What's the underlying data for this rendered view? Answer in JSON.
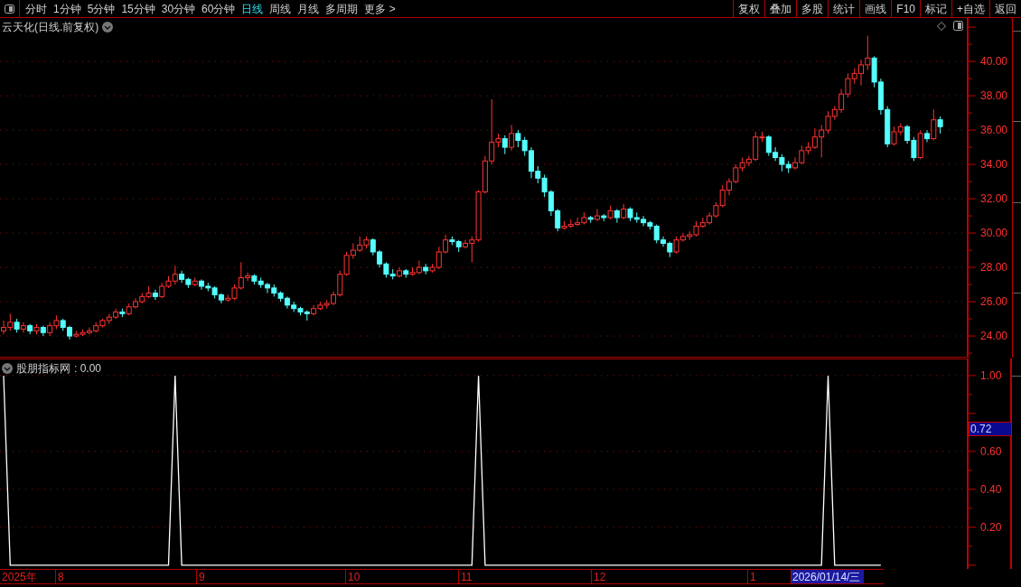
{
  "toolbar": {
    "periods": [
      {
        "label": "分时",
        "selected": false
      },
      {
        "label": "1分钟",
        "selected": false
      },
      {
        "label": "5分钟",
        "selected": false
      },
      {
        "label": "15分钟",
        "selected": false
      },
      {
        "label": "30分钟",
        "selected": false
      },
      {
        "label": "60分钟",
        "selected": false
      },
      {
        "label": "日线",
        "selected": true
      },
      {
        "label": "周线",
        "selected": false
      },
      {
        "label": "月线",
        "selected": false
      },
      {
        "label": "多周期",
        "selected": false
      },
      {
        "label": "更多 >",
        "selected": false
      }
    ],
    "actions": [
      "复权",
      "叠加",
      "多股",
      "统计",
      "画线",
      "F10",
      "标记",
      "+自选",
      "返回"
    ]
  },
  "price_panel": {
    "title": "云天化(日线.前复权)",
    "chart_data": {
      "type": "candlestick",
      "ylim": [
        22.74,
        42.53
      ],
      "grid": true,
      "yticks": [
        {
          "value": 40,
          "label": "40.00"
        },
        {
          "value": 38,
          "label": "38.00"
        },
        {
          "value": 36,
          "label": "36.00"
        },
        {
          "value": 34,
          "label": "34.00"
        },
        {
          "value": 32,
          "label": "32.00"
        },
        {
          "value": 30,
          "label": "30.00"
        },
        {
          "value": 28,
          "label": "28.00"
        },
        {
          "value": 26,
          "label": "26.00"
        },
        {
          "value": 24,
          "label": "24.00"
        }
      ],
      "ohlc": [
        [
          24.3,
          24.9,
          24.1,
          24.5
        ],
        [
          24.5,
          25.3,
          24.3,
          24.8
        ],
        [
          24.8,
          25.0,
          24.2,
          24.4
        ],
        [
          24.4,
          24.8,
          24.2,
          24.6
        ],
        [
          24.6,
          24.7,
          24.1,
          24.3
        ],
        [
          24.3,
          24.7,
          24.1,
          24.5
        ],
        [
          24.5,
          24.6,
          24.0,
          24.2
        ],
        [
          24.2,
          24.8,
          24.0,
          24.6
        ],
        [
          24.6,
          25.2,
          24.4,
          24.9
        ],
        [
          24.9,
          25.0,
          24.3,
          24.5
        ],
        [
          24.5,
          24.6,
          23.8,
          24.0
        ],
        [
          24.0,
          24.3,
          23.9,
          24.1
        ],
        [
          24.1,
          24.4,
          24.0,
          24.2
        ],
        [
          24.2,
          24.5,
          24.1,
          24.3
        ],
        [
          24.3,
          24.8,
          24.2,
          24.6
        ],
        [
          24.6,
          25.0,
          24.5,
          24.9
        ],
        [
          24.9,
          25.3,
          24.7,
          25.1
        ],
        [
          25.1,
          25.6,
          25.0,
          25.4
        ],
        [
          25.4,
          25.6,
          25.1,
          25.3
        ],
        [
          25.3,
          25.9,
          25.2,
          25.7
        ],
        [
          25.7,
          26.2,
          25.6,
          26.0
        ],
        [
          26.0,
          26.5,
          25.9,
          26.3
        ],
        [
          26.3,
          26.9,
          26.2,
          26.5
        ],
        [
          26.5,
          26.7,
          26.1,
          26.3
        ],
        [
          26.3,
          27.1,
          26.2,
          26.9
        ],
        [
          26.9,
          27.5,
          26.8,
          27.2
        ],
        [
          27.2,
          28.1,
          27.0,
          27.6
        ],
        [
          27.6,
          27.8,
          27.1,
          27.3
        ],
        [
          27.3,
          27.4,
          26.8,
          27.0
        ],
        [
          27.0,
          27.4,
          26.9,
          27.2
        ],
        [
          27.2,
          27.3,
          26.7,
          26.9
        ],
        [
          26.9,
          27.1,
          26.6,
          26.8
        ],
        [
          26.8,
          26.9,
          26.2,
          26.4
        ],
        [
          26.4,
          26.5,
          25.9,
          26.1
        ],
        [
          26.1,
          26.4,
          26.0,
          26.2
        ],
        [
          26.2,
          27.0,
          26.1,
          26.8
        ],
        [
          26.8,
          28.3,
          26.7,
          27.4
        ],
        [
          27.4,
          27.7,
          27.2,
          27.5
        ],
        [
          27.5,
          27.6,
          27.0,
          27.2
        ],
        [
          27.2,
          27.4,
          26.8,
          27.0
        ],
        [
          27.0,
          27.1,
          26.5,
          26.8
        ],
        [
          26.8,
          27.0,
          26.3,
          26.5
        ],
        [
          26.5,
          26.6,
          26.0,
          26.2
        ],
        [
          26.2,
          26.3,
          25.6,
          25.8
        ],
        [
          25.8,
          26.0,
          25.4,
          25.6
        ],
        [
          25.6,
          25.7,
          25.2,
          25.4
        ],
        [
          25.4,
          25.5,
          24.9,
          25.3
        ],
        [
          25.3,
          25.8,
          25.2,
          25.6
        ],
        [
          25.6,
          26.0,
          25.5,
          25.8
        ],
        [
          25.8,
          26.1,
          25.6,
          25.9
        ],
        [
          25.9,
          26.6,
          25.8,
          26.4
        ],
        [
          26.4,
          27.8,
          26.3,
          27.6
        ],
        [
          27.6,
          28.9,
          27.5,
          28.7
        ],
        [
          28.7,
          29.4,
          28.5,
          29.0
        ],
        [
          29.0,
          29.8,
          28.9,
          29.3
        ],
        [
          29.3,
          29.8,
          29.1,
          29.6
        ],
        [
          29.6,
          29.7,
          28.7,
          28.9
        ],
        [
          28.9,
          29.0,
          28.0,
          28.2
        ],
        [
          28.2,
          28.3,
          27.4,
          27.6
        ],
        [
          27.6,
          27.9,
          27.3,
          27.5
        ],
        [
          27.5,
          28.0,
          27.4,
          27.8
        ],
        [
          27.8,
          27.9,
          27.4,
          27.6
        ],
        [
          27.6,
          28.0,
          27.5,
          27.7
        ],
        [
          27.7,
          28.4,
          27.6,
          28.0
        ],
        [
          28.0,
          28.2,
          27.6,
          27.8
        ],
        [
          27.8,
          28.2,
          27.7,
          28.0
        ],
        [
          28.0,
          29.2,
          27.9,
          28.9
        ],
        [
          28.9,
          29.9,
          28.8,
          29.6
        ],
        [
          29.6,
          29.8,
          29.3,
          29.5
        ],
        [
          29.5,
          29.6,
          28.9,
          29.2
        ],
        [
          29.2,
          29.6,
          29.1,
          29.4
        ],
        [
          29.4,
          29.8,
          28.3,
          29.6
        ],
        [
          29.6,
          32.5,
          29.5,
          32.4
        ],
        [
          32.4,
          34.5,
          32.3,
          34.2
        ],
        [
          34.2,
          37.8,
          34.0,
          35.3
        ],
        [
          35.3,
          35.8,
          35.0,
          35.5
        ],
        [
          35.5,
          35.7,
          34.6,
          35.0
        ],
        [
          35.0,
          36.3,
          34.8,
          35.8
        ],
        [
          35.8,
          36.0,
          35.0,
          35.4
        ],
        [
          35.4,
          35.6,
          34.5,
          34.8
        ],
        [
          34.8,
          35.0,
          33.2,
          33.6
        ],
        [
          33.6,
          33.9,
          32.9,
          33.2
        ],
        [
          33.2,
          33.4,
          32.1,
          32.4
        ],
        [
          32.4,
          32.5,
          31.0,
          31.3
        ],
        [
          31.3,
          31.4,
          30.1,
          30.3
        ],
        [
          30.3,
          30.7,
          30.2,
          30.4
        ],
        [
          30.4,
          30.8,
          30.3,
          30.5
        ],
        [
          30.5,
          30.9,
          30.4,
          30.6
        ],
        [
          30.6,
          31.2,
          30.5,
          30.9
        ],
        [
          30.9,
          31.0,
          30.6,
          30.8
        ],
        [
          30.8,
          31.4,
          30.7,
          31.0
        ],
        [
          31.0,
          31.1,
          30.7,
          30.9
        ],
        [
          30.9,
          31.6,
          30.8,
          31.3
        ],
        [
          31.3,
          31.4,
          30.6,
          30.9
        ],
        [
          30.9,
          31.7,
          30.8,
          31.4
        ],
        [
          31.4,
          31.5,
          30.7,
          30.9
        ],
        [
          30.9,
          31.2,
          30.6,
          30.8
        ],
        [
          30.8,
          31.0,
          30.4,
          30.6
        ],
        [
          30.6,
          30.7,
          30.2,
          30.4
        ],
        [
          30.4,
          30.5,
          29.4,
          29.6
        ],
        [
          29.6,
          29.8,
          29.2,
          29.4
        ],
        [
          29.4,
          29.5,
          28.6,
          28.9
        ],
        [
          28.9,
          29.8,
          28.8,
          29.6
        ],
        [
          29.6,
          30.0,
          29.5,
          29.8
        ],
        [
          29.8,
          30.1,
          29.6,
          29.9
        ],
        [
          29.9,
          30.7,
          29.8,
          30.4
        ],
        [
          30.4,
          30.9,
          30.3,
          30.6
        ],
        [
          30.6,
          31.2,
          30.5,
          31.0
        ],
        [
          31.0,
          31.8,
          30.9,
          31.6
        ],
        [
          31.6,
          32.8,
          31.5,
          32.5
        ],
        [
          32.5,
          33.2,
          32.2,
          33.0
        ],
        [
          33.0,
          34.0,
          32.9,
          33.8
        ],
        [
          33.8,
          34.4,
          33.6,
          34.1
        ],
        [
          34.1,
          34.5,
          33.9,
          34.3
        ],
        [
          34.3,
          35.9,
          34.2,
          35.6
        ],
        [
          35.6,
          35.9,
          35.3,
          35.6
        ],
        [
          35.6,
          35.7,
          34.5,
          34.7
        ],
        [
          34.7,
          35.0,
          34.2,
          34.4
        ],
        [
          34.4,
          34.6,
          33.6,
          34.0
        ],
        [
          34.0,
          34.2,
          33.5,
          33.8
        ],
        [
          33.8,
          34.4,
          33.7,
          34.1
        ],
        [
          34.1,
          35.1,
          34.0,
          34.8
        ],
        [
          34.8,
          35.3,
          34.6,
          35.0
        ],
        [
          35.0,
          36.1,
          34.9,
          35.6
        ],
        [
          35.6,
          36.3,
          34.4,
          36.0
        ],
        [
          36.0,
          37.1,
          35.8,
          36.8
        ],
        [
          36.8,
          37.4,
          36.6,
          37.2
        ],
        [
          37.2,
          38.4,
          37.0,
          38.1
        ],
        [
          38.1,
          39.3,
          37.9,
          39.0
        ],
        [
          39.0,
          39.6,
          38.7,
          39.3
        ],
        [
          39.3,
          40.1,
          38.6,
          39.8
        ],
        [
          39.8,
          41.5,
          39.5,
          40.2
        ],
        [
          40.2,
          40.3,
          38.5,
          38.8
        ],
        [
          38.8,
          39.0,
          36.9,
          37.2
        ],
        [
          37.2,
          37.4,
          35.0,
          35.2
        ],
        [
          35.2,
          36.2,
          35.1,
          35.9
        ],
        [
          35.9,
          36.4,
          35.7,
          36.2
        ],
        [
          36.2,
          36.3,
          35.2,
          35.4
        ],
        [
          35.4,
          35.6,
          34.2,
          34.4
        ],
        [
          34.4,
          36.0,
          34.3,
          35.8
        ],
        [
          35.8,
          36.0,
          35.3,
          35.5
        ],
        [
          35.5,
          37.2,
          35.4,
          36.6
        ],
        [
          36.6,
          36.8,
          35.8,
          36.2
        ]
      ]
    }
  },
  "indicator_panel": {
    "value": ": 0.00",
    "cursor_value": "0.72",
    "chart_data": {
      "type": "line",
      "ylim": [
        -0.02,
        1.09
      ],
      "grid": true,
      "yticks": [
        {
          "value": 1,
          "label": "1.00"
        },
        {
          "value": 0.6,
          "label": "0.60"
        },
        {
          "value": 0.4,
          "label": "0.40"
        },
        {
          "value": 0.2,
          "label": "0.20"
        }
      ],
      "series": [
        {
          "name": "股朋指标网",
          "color": "#ffffff",
          "values": [
            1,
            0,
            0,
            0,
            0,
            0,
            0,
            0,
            0,
            0,
            0,
            0,
            0,
            0,
            0,
            0,
            0,
            0,
            0,
            0,
            0,
            0,
            0,
            0,
            0,
            0,
            1,
            0,
            0,
            0,
            0,
            0,
            0,
            0,
            0,
            0,
            0,
            0,
            0,
            0,
            0,
            0,
            0,
            0,
            0,
            0,
            0,
            0,
            0,
            0,
            0,
            0,
            0,
            0,
            0,
            0,
            0,
            0,
            0,
            0,
            0,
            0,
            0,
            0,
            0,
            0,
            0,
            0,
            0,
            0,
            0,
            0,
            1,
            0,
            0,
            0,
            0,
            0,
            0,
            0,
            0,
            0,
            0,
            0,
            0,
            0,
            0,
            0,
            0,
            0,
            0,
            0,
            0,
            0,
            0,
            0,
            0,
            0,
            0,
            0,
            0,
            0,
            0,
            0,
            0,
            0,
            0,
            0,
            0,
            0,
            0,
            0,
            0,
            0,
            0,
            0,
            0,
            0,
            0,
            0,
            0,
            0,
            0,
            0,
            0,
            1,
            0,
            0,
            0,
            0,
            0,
            0,
            0,
            0
          ]
        }
      ]
    }
  },
  "date_axis": {
    "labels": [
      {
        "text": "2025年",
        "selected": false
      },
      {
        "text": "8",
        "selected": false
      },
      {
        "text": "9",
        "selected": false
      },
      {
        "text": "10",
        "selected": false
      },
      {
        "text": "11",
        "selected": false
      },
      {
        "text": "12",
        "selected": false
      },
      {
        "text": "1",
        "selected": false
      },
      {
        "text": "2026/01/14/三",
        "selected": true
      }
    ]
  }
}
